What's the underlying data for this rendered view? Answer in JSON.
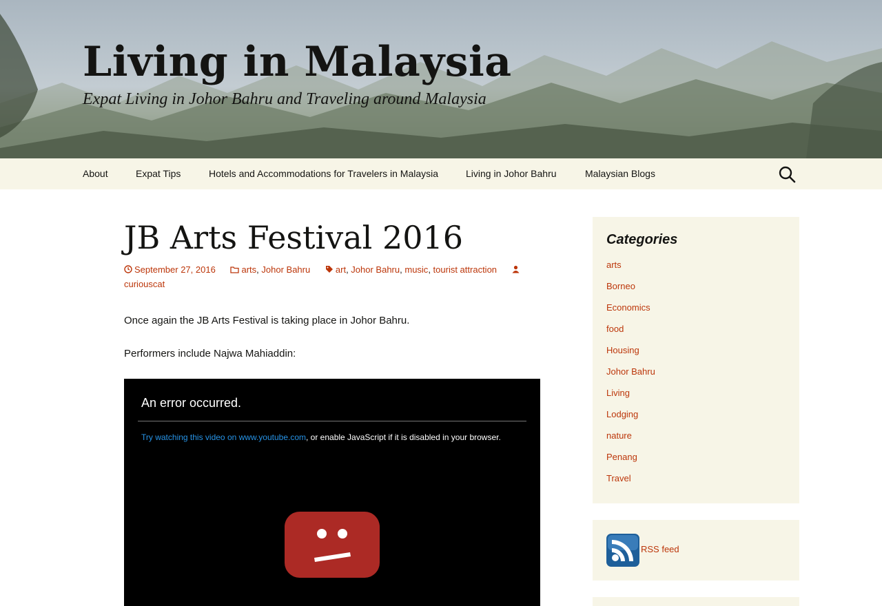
{
  "header": {
    "site_title": "Living in Malaysia",
    "site_description": "Expat Living in Johor Bahru and Traveling around Malaysia"
  },
  "nav": {
    "items": [
      {
        "label": "About"
      },
      {
        "label": "Expat Tips"
      },
      {
        "label": "Hotels and Accommodations for Travelers in Malaysia"
      },
      {
        "label": "Living in Johor Bahru"
      },
      {
        "label": "Malaysian Blogs"
      }
    ],
    "search_icon": "search-icon"
  },
  "entry": {
    "title": "JB Arts Festival 2016",
    "meta": {
      "date": "September 27, 2016",
      "categories": [
        "arts",
        "Johor Bahru"
      ],
      "tags": [
        "art",
        "Johor Bahru",
        "music",
        "tourist attraction"
      ],
      "author": "curiouscat"
    },
    "paragraphs": [
      "Once again the JB Arts Festival is taking place in Johor Bahru.",
      "Performers include Najwa Mahiaddin:"
    ],
    "video": {
      "error_title": "An error occurred.",
      "link_text": "Try watching this video on www.youtube.com",
      "message_rest": ", or enable JavaScript if it is disabled in your browser."
    }
  },
  "sidebar": {
    "categories_title": "Categories",
    "categories": [
      "arts",
      "Borneo",
      "Economics",
      "food",
      "Housing",
      "Johor Bahru",
      "Living",
      "Lodging",
      "nature",
      "Penang",
      "Travel"
    ],
    "rss_label": "RSS feed"
  },
  "colors": {
    "link": "#bc360a",
    "nav_bg": "#f7f5e7",
    "youtube_red": "#c4302b"
  }
}
